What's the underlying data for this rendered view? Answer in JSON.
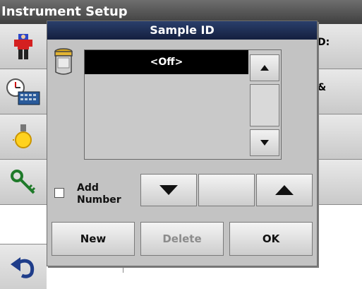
{
  "background": {
    "title": "Instrument Setup",
    "right_tiles": [
      "D:",
      "&",
      "",
      ""
    ]
  },
  "dialog": {
    "title": "Sample ID",
    "list_items": [
      "<Off>"
    ],
    "add_number_label_line1": "Add",
    "add_number_label_line2": "Number",
    "add_number_checked": false,
    "buttons": {
      "new": "New",
      "delete": "Delete",
      "ok": "OK"
    }
  },
  "icons": {
    "background_left": [
      "person-icon",
      "clock-keyboard-icon",
      "lamp-icon",
      "key-icon",
      "back-arrow-icon"
    ],
    "dialog": [
      "sample-jar-icon",
      "scroll-up-icon",
      "scroll-down-icon",
      "arrow-down-icon",
      "arrow-up-icon"
    ]
  },
  "colors": {
    "title_bar": "#141f3f",
    "selected_row": "#000000"
  }
}
